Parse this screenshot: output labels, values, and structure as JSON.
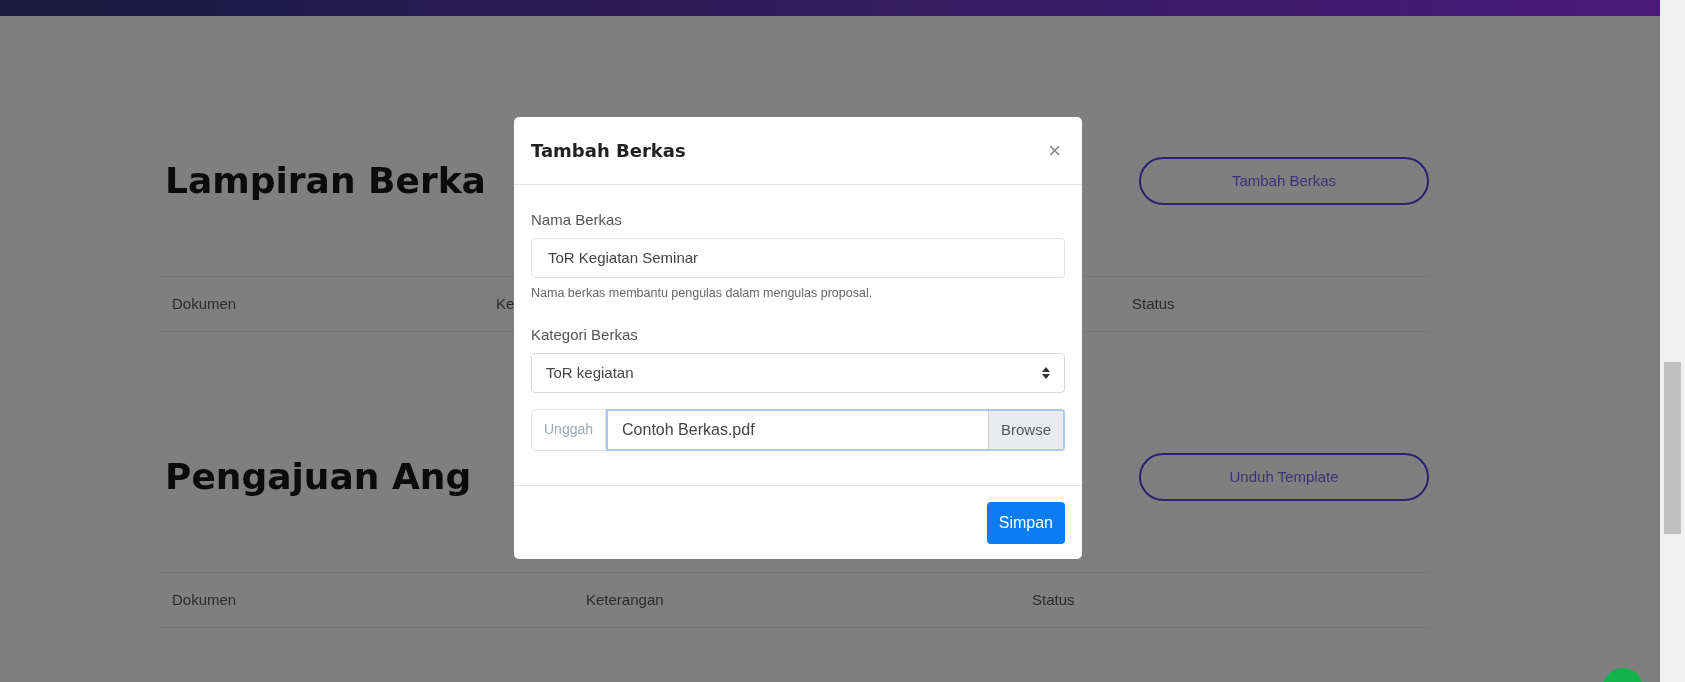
{
  "sections": [
    {
      "title": "Lampiran Berka",
      "button": "Tambah Berkas",
      "columns": [
        "Dokumen",
        "Ke",
        "Status"
      ]
    },
    {
      "title": "Pengajuan Ang",
      "button": "Unduh Template",
      "columns": [
        "Dokumen",
        "Keterangan",
        "Status"
      ]
    }
  ],
  "modal": {
    "title": "Tambah Berkas",
    "close": "×",
    "fields": [
      {
        "kind": "text",
        "label": "Nama Berkas",
        "value": "ToR Kegiatan Seminar",
        "help": "Nama berkas membantu pengulas dalam mengulas proposal."
      },
      {
        "kind": "select",
        "label": "Kategori Berkas",
        "value": "ToR kegiatan"
      },
      {
        "kind": "file",
        "addon": "Unggah",
        "value": "Contoh Berkas.pdf",
        "button": "Browse",
        "focused": true
      }
    ],
    "submit": "Simpan"
  }
}
